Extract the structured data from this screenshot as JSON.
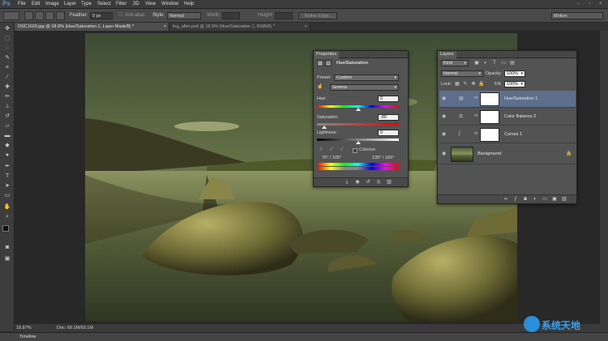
{
  "menubar": {
    "logo": "Ps",
    "items": [
      "File",
      "Edit",
      "Image",
      "Layer",
      "Type",
      "Select",
      "Filter",
      "3D",
      "View",
      "Window",
      "Help"
    ]
  },
  "options": {
    "feather_label": "Feather:",
    "feather_value": "0 px",
    "antialias_label": "Anti-alias",
    "style_label": "Style:",
    "style_value": "Normal",
    "width_label": "Width:",
    "height_label": "Height:",
    "refine_label": "Refine Edge...",
    "workspace": "Motion"
  },
  "tabs": [
    {
      "label": "DSC1029.jpg @ 18.9% (Hue/Saturation 1, Layer Mask/8) *",
      "close": "×"
    },
    {
      "label": "fog_after.psd @ 18.9% (Hue/Saturation 1, RGB/8) *",
      "close": "×"
    }
  ],
  "status": {
    "zoom": "18.87%",
    "doc": "Doc: 69.1M/69.1M"
  },
  "timeline": {
    "label": "Timeline"
  },
  "properties": {
    "panel_title": "Properties",
    "header": "Hue/Saturation",
    "preset_label": "Preset:",
    "preset_value": "Custom",
    "channel_value": "Greens",
    "hue_label": "Hue:",
    "hue_value": "0",
    "saturation_label": "Saturation:",
    "saturation_value": "-80",
    "lightness_label": "Lightness:",
    "lightness_value": "0",
    "colorize_label": "Colorize",
    "range_left": "75° / 105°",
    "range_right": "135° \\ 165°"
  },
  "layers": {
    "panel_title": "Layers",
    "kind_label": "Kind",
    "blend_mode": "Normal",
    "opacity_label": "Opacity:",
    "opacity_value": "100%",
    "lock_label": "Lock:",
    "fill_label": "Fill:",
    "fill_value": "100%",
    "items": [
      {
        "name": "Hue/Saturation 1",
        "selected": true
      },
      {
        "name": "Color Balance 2",
        "selected": false
      },
      {
        "name": "Curves 1",
        "selected": false
      },
      {
        "name": "Background",
        "selected": false
      }
    ]
  },
  "watermark": {
    "text": "系统天地"
  },
  "colors": {
    "accent": "#5d6f8c",
    "panel": "#535353",
    "logo": "#39a0e6"
  }
}
